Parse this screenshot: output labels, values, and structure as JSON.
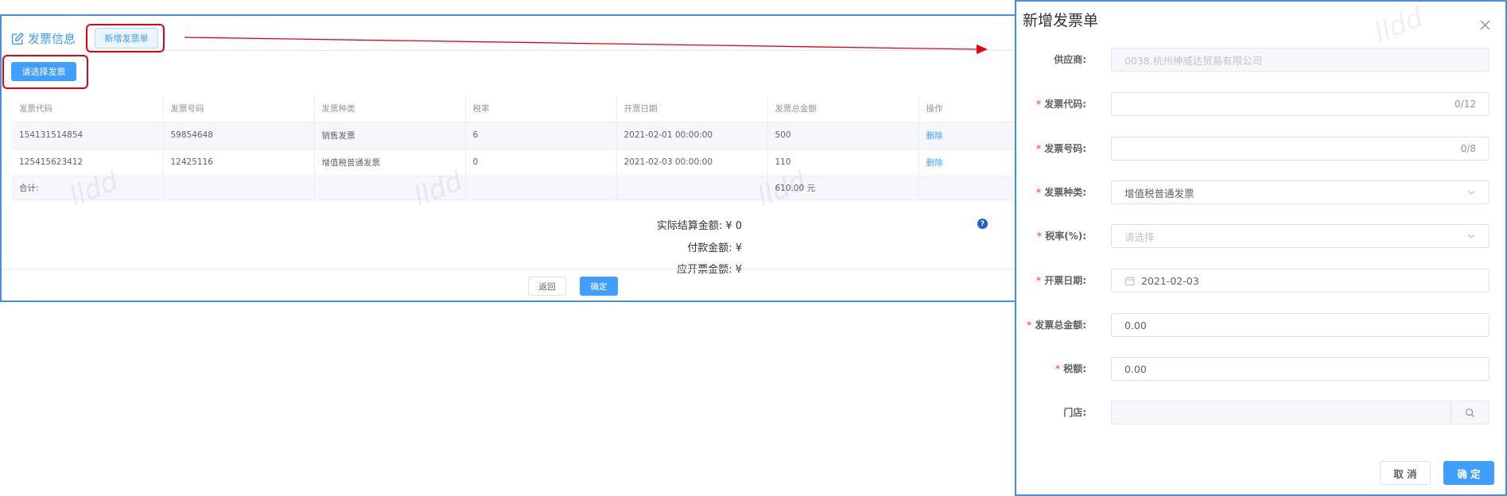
{
  "main": {
    "title": "发票信息",
    "tab_button": "新增发票单",
    "select_button": "请选择发票",
    "columns": [
      "发票代码",
      "发票号码",
      "发票种类",
      "税率",
      "开票日期",
      "发票总金额",
      "操作"
    ],
    "rows": [
      {
        "code": "154131514854",
        "number": "59854648",
        "type": "销售发票",
        "rate": "6",
        "date": "2021-02-01 00:00:00",
        "amount": "500",
        "action": "删除"
      },
      {
        "code": "125415623412",
        "number": "12425116",
        "type": "增值税普通发票",
        "rate": "0",
        "date": "2021-02-03 00:00:00",
        "amount": "110",
        "action": "删除"
      }
    ],
    "total_row": {
      "label": "合计:",
      "amount": "610.00 元"
    },
    "summary": {
      "actual": "实际结算金额: ¥ 0",
      "paid": "付款金额: ¥",
      "invoice_due": "应开票金额: ¥"
    },
    "help_glyph": "?",
    "buttons": {
      "back": "返回",
      "confirm": "确定"
    }
  },
  "watermark": "lldd",
  "dialog": {
    "title": "新增发票单",
    "fields": {
      "supplier": {
        "label": "供应商:",
        "value": "0038.杭州绅威达贸易有限公司"
      },
      "code": {
        "label": "发票代码:",
        "value": "",
        "counter": "0/12"
      },
      "number": {
        "label": "发票号码:",
        "value": "",
        "counter": "0/8"
      },
      "type": {
        "label": "发票种类:",
        "value": "增值税普通发票"
      },
      "rate": {
        "label": "税率(%):",
        "placeholder": "请选择"
      },
      "date": {
        "label": "开票日期:",
        "value": "2021-02-03"
      },
      "amount": {
        "label": "发票总金额:",
        "value": "0.00"
      },
      "tax": {
        "label": "税额:",
        "value": "0.00"
      },
      "store": {
        "label": "门店:",
        "value": ""
      }
    },
    "required_mark": "*",
    "buttons": {
      "cancel": "取 消",
      "confirm": "确 定"
    }
  },
  "colors": {
    "primary": "#409eff",
    "highlight": "#e60012",
    "frame": "#4a8fd6",
    "required": "#f56c6c"
  },
  "icons": [
    "edit-icon",
    "help-icon",
    "close-icon",
    "chevron-down-icon",
    "calendar-icon",
    "search-icon"
  ]
}
